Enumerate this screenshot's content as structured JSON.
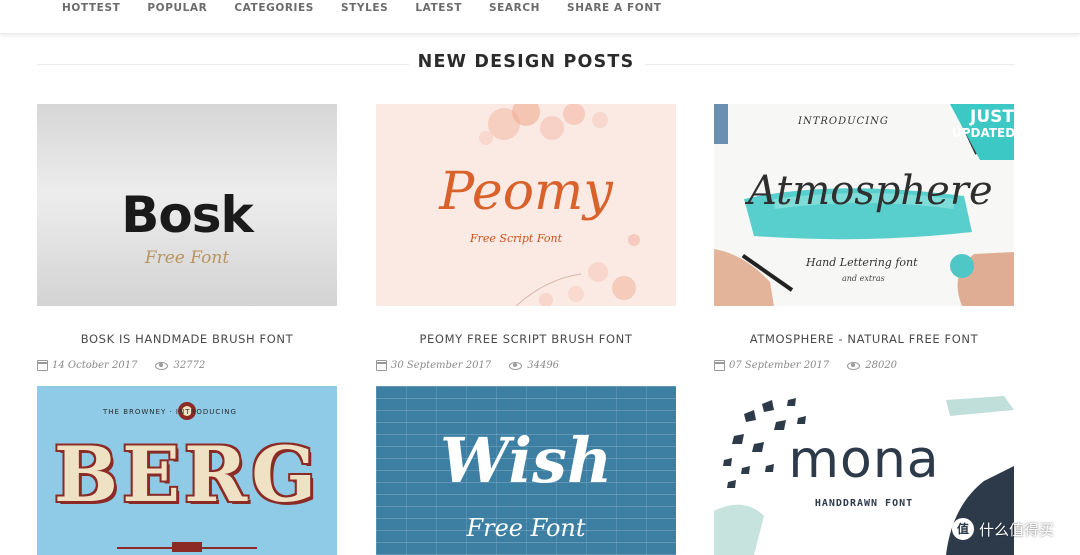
{
  "nav": {
    "items": [
      "HOTTEST",
      "POPULAR",
      "CATEGORIES",
      "STYLES",
      "LATEST",
      "SEARCH",
      "SHARE A FONT"
    ]
  },
  "section": {
    "title": "NEW DESIGN POSTS"
  },
  "posts": [
    {
      "title": "BOSK IS HANDMADE BRUSH FONT",
      "date": "14 October 2017",
      "views": "32772",
      "thumb": {
        "main": "Bosk",
        "sub": "Free Font"
      }
    },
    {
      "title": "PEOMY FREE SCRIPT BRUSH FONT",
      "date": "30 September 2017",
      "views": "34496",
      "thumb": {
        "main": "Peomy",
        "sub": "Free Script Font"
      }
    },
    {
      "title": "ATMOSPHERE - NATURAL FREE FONT",
      "date": "07 September 2017",
      "views": "28020",
      "thumb": {
        "main": "Atmosphere",
        "top": "INTRODUCING",
        "sub": "Hand Lettering font",
        "sub2": "and extras",
        "badge_1": "JUST",
        "badge_2": "UPDATED"
      }
    },
    {
      "thumb": {
        "main": "BERG",
        "top": "THE BROWNEY · INTRODUCING"
      }
    },
    {
      "thumb": {
        "main": "Wish",
        "sub": "Free Font"
      }
    },
    {
      "thumb": {
        "main": "mona",
        "sub": "HANDDRAWN FONT"
      }
    }
  ],
  "watermark": {
    "text": "什么值得买",
    "logo": "值"
  },
  "colors": {
    "nav_text": "#6b6b6b",
    "title_text": "#2b2b2b",
    "peomy_ink": "#d9622b",
    "atmosphere_teal": "#3cc8c4",
    "berg_red": "#8c2b25",
    "wish_blue": "#3d7fa3"
  }
}
